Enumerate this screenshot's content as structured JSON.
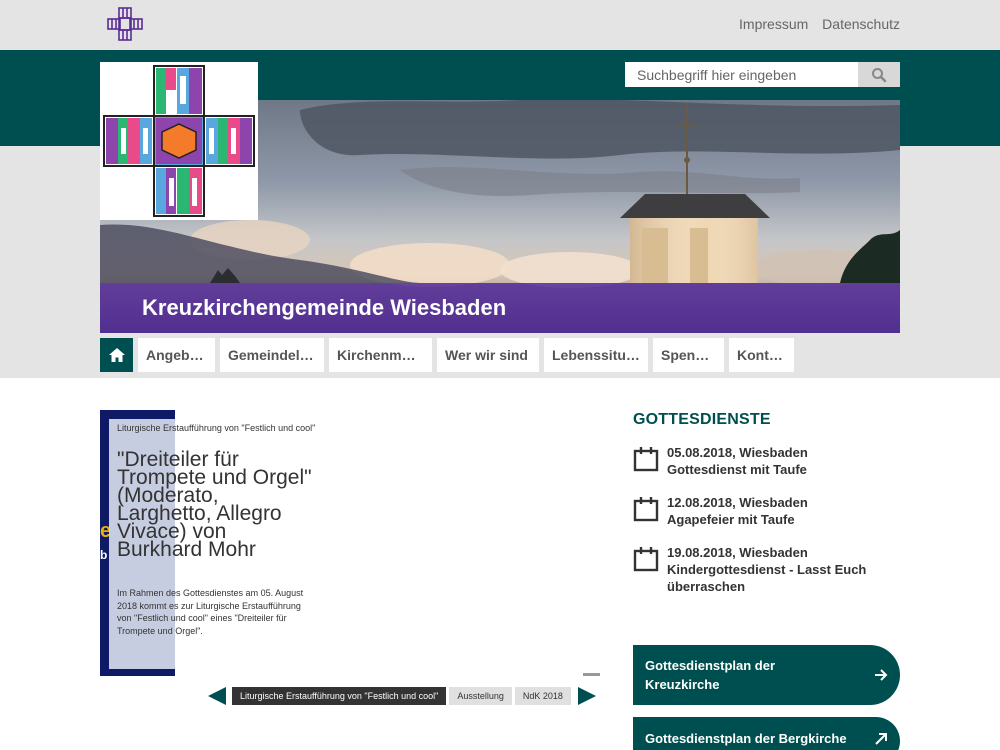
{
  "topbar": {
    "links": [
      "Impressum",
      "Datenschutz"
    ]
  },
  "search": {
    "placeholder": "Suchbegriff hier eingeben"
  },
  "hero": {
    "title": "Kreuzkirchengemeinde Wiesbaden"
  },
  "nav": {
    "items": [
      "Angebote",
      "Gemeindel…",
      "Kirchenmusik",
      "Wer wir sind",
      "Lebenssitu…",
      "Spenden",
      "Kontakt"
    ]
  },
  "slider": {
    "partial_text_1": "e",
    "partial_text_2": "b",
    "kicker": "Liturgische Erstaufführung von \"Festlich und cool\"",
    "headline": "\"Dreiteiler für Trompete und Orgel\" (Moderato, Larghetto, Allegro Vivace) von Burkhard Mohr",
    "body": "Im Rahmen des Gottesdienstes am 05. August 2018 kommt es zur Liturgische Erstaufführung von \"Festlich und cool\" eines \"Dreiteiler für Trompete und Orgel\".",
    "tabs": [
      "Liturgische Erstaufführung von \"Festlich und cool\"",
      "Ausstellung",
      "NdK 2018"
    ]
  },
  "gottesdienste": {
    "title": "GOTTESDIENSTE",
    "items": [
      {
        "line1": "05.08.2018, Wiesbaden",
        "line2": "Gottesdienst mit Taufe",
        "line3": ""
      },
      {
        "line1": "12.08.2018, Wiesbaden",
        "line2": "Agapefeier mit Taufe",
        "line3": ""
      },
      {
        "line1": "19.08.2018, Wiesbaden",
        "line2": "Kindergottesdienst - Lasst Euch",
        "line3": "überraschen"
      }
    ]
  },
  "buttons": {
    "plan1_line1": "Gottesdienstplan der",
    "plan1_line2": "Kreuzkirche",
    "plan2": "Gottesdienstplan der Bergkirche"
  },
  "colors": {
    "teal": "#004f50",
    "purple_bar": "#5a2d96",
    "slide_dark": "#0e1a66"
  }
}
